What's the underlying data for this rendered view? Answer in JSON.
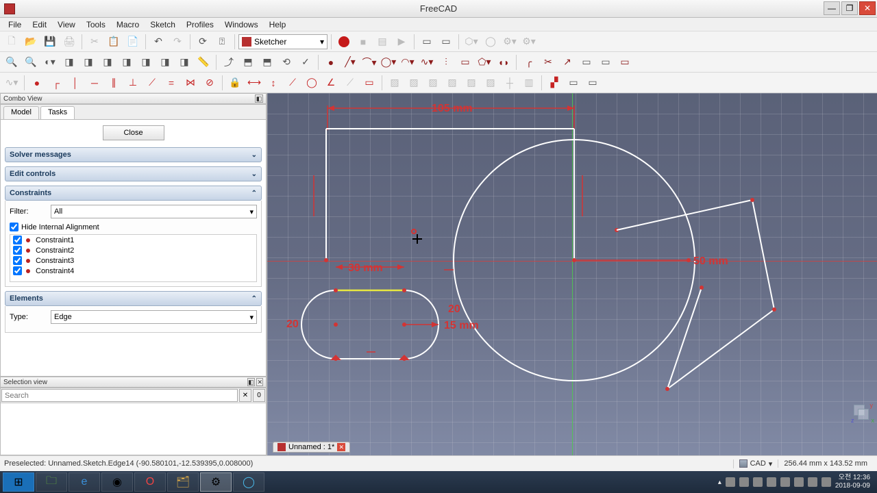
{
  "title": "FreeCAD",
  "menus": [
    "File",
    "Edit",
    "View",
    "Tools",
    "Macro",
    "Sketch",
    "Profiles",
    "Windows",
    "Help"
  ],
  "workbench": "Sketcher",
  "combo_view_title": "Combo View",
  "tabs": {
    "model": "Model",
    "tasks": "Tasks"
  },
  "close_label": "Close",
  "sections": {
    "solver": "Solver messages",
    "edit": "Edit controls",
    "constraints": "Constraints",
    "elements": "Elements"
  },
  "filter": {
    "label": "Filter:",
    "value": "All"
  },
  "hide_internal": "Hide Internal Alignment",
  "constraints_list": [
    "Constraint1",
    "Constraint2",
    "Constraint3",
    "Constraint4"
  ],
  "elements_type": {
    "label": "Type:",
    "value": "Edge"
  },
  "selection_view_title": "Selection view",
  "search_placeholder": "Search",
  "selection_count": "0",
  "dimensions": {
    "top": "105 mm",
    "left": "30 mm",
    "slot_r": "15 mm",
    "right": "50 mm",
    "slot_h": "20",
    "slot_v": "20"
  },
  "doc_tab": "Unnamed : 1*",
  "status": {
    "preselect": "Preselected: Unnamed.Sketch.Edge14 (-90.580101,-12.539395,0.008000)",
    "mode": "CAD",
    "coords": "256.44 mm x 143.52 mm"
  },
  "clock": {
    "line1": "오전 12:36",
    "line2": "2018-09-09"
  }
}
